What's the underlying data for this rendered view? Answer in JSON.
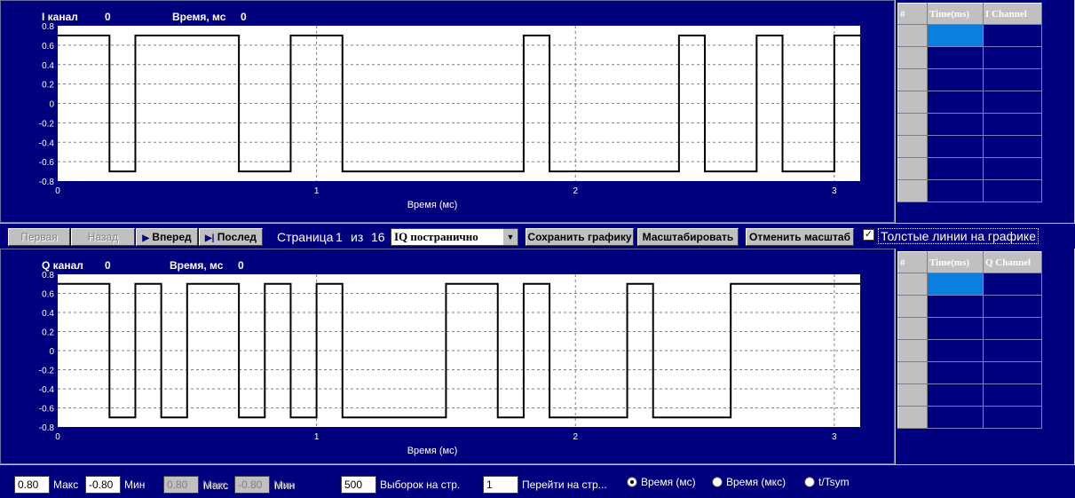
{
  "i_panel": {
    "channel_label": "I канал",
    "channel_value": "0",
    "time_label": "Время, мс",
    "time_value": "0",
    "table": {
      "col_index": "#",
      "col_time": "Time(ms)",
      "col_channel": "I Channel"
    }
  },
  "q_panel": {
    "channel_label": "Q канал",
    "channel_value": "0",
    "time_label": "Время, мс",
    "time_value": "0",
    "table": {
      "col_index": "#",
      "col_time": "Time(ms)",
      "col_channel": "Q Channel"
    }
  },
  "toolbar": {
    "first_label": "Первая",
    "back_label": "Назад",
    "forward_label": "Вперед",
    "last_label": "Послед",
    "page_label": "Страница",
    "page_current": "1",
    "page_of": "из",
    "page_total": "16",
    "mode_select": "IQ постранично",
    "save_label": "Сохранить графику",
    "scale_label": "Масштабировать",
    "unscale_label": "Отменить масштаб",
    "thick_lines_label": "Толстые линии на графике",
    "thick_lines_checked": true
  },
  "bottom": {
    "max1_value": "0.80",
    "max1_label": "Макс",
    "min1_value": "-0.80",
    "min1_label": "Мин",
    "max2_value": "0.80",
    "max2_label": "Макс",
    "min2_value": "-0.80",
    "min2_label": "Мин",
    "samples_value": "500",
    "samples_label": "Выборок на стр.",
    "goto_value": "1",
    "goto_label": "Перейти на стр...",
    "radio_ms_label": "Время (мс)",
    "radio_us_label": "Время (мкс)",
    "radio_tsym_label": "t/Tsym",
    "selected_radio": "ms"
  },
  "colors": {
    "panel": "#00007f",
    "grid_select": "#0a7fdf",
    "plot_bg": "#ffffff"
  },
  "chart_data": [
    {
      "type": "line",
      "xlabel": "Время (мс)",
      "ylim": [
        -0.8,
        0.8
      ],
      "xlim": [
        0,
        3.1
      ],
      "yticks": [
        "0.8",
        "0.6",
        "0.4",
        "0.2",
        "0",
        "-0.2",
        "-0.4",
        "-0.6",
        "-0.8"
      ],
      "xticks": [
        "0",
        "1",
        "2",
        "3"
      ],
      "grid": true,
      "series": [
        {
          "step_x": [
            0,
            0.2,
            0.3,
            0.7,
            0.9,
            1.1,
            1.8,
            1.9,
            2.4,
            2.5,
            2.7,
            2.8,
            3.0,
            3.1
          ],
          "step_y": [
            0.7,
            -0.7,
            0.7,
            -0.7,
            0.7,
            -0.7,
            0.7,
            -0.7,
            0.7,
            -0.7,
            0.7,
            -0.7,
            0.7
          ]
        }
      ]
    },
    {
      "type": "line",
      "xlabel": "Время (мс)",
      "ylim": [
        -0.8,
        0.8
      ],
      "xlim": [
        0,
        3.1
      ],
      "yticks": [
        "0.8",
        "0.6",
        "0.4",
        "0.2",
        "0",
        "-0.2",
        "-0.4",
        "-0.6",
        "-0.8"
      ],
      "xticks": [
        "0",
        "1",
        "2",
        "3"
      ],
      "grid": true,
      "series": [
        {
          "step_x": [
            0,
            0.2,
            0.3,
            0.4,
            0.5,
            0.7,
            0.8,
            0.9,
            1.0,
            1.1,
            1.5,
            1.7,
            1.8,
            1.9,
            2.2,
            2.3,
            2.6,
            3.1
          ],
          "step_y": [
            0.7,
            -0.7,
            0.7,
            -0.7,
            0.7,
            -0.7,
            0.7,
            -0.7,
            0.7,
            -0.7,
            0.7,
            -0.7,
            0.7,
            -0.7,
            0.7,
            -0.7,
            0.7
          ]
        }
      ]
    }
  ]
}
